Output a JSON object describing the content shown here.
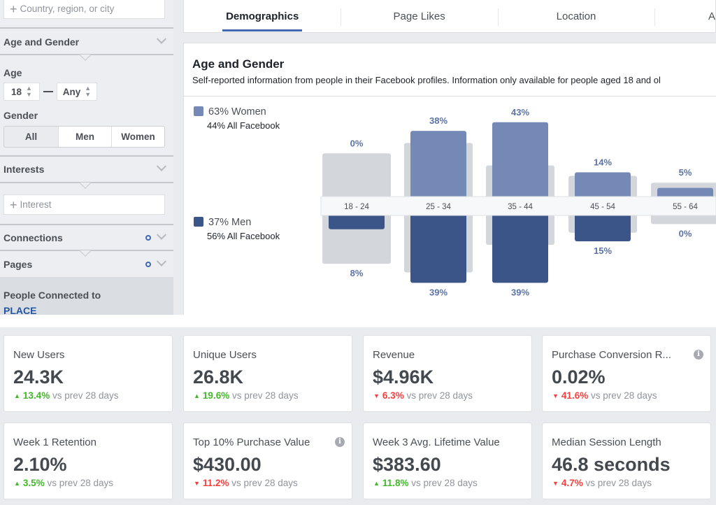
{
  "sidebar": {
    "location_placeholder": "Country, region, or city",
    "sections": {
      "age_gender": "Age and Gender",
      "interests": "Interests",
      "connections": "Connections",
      "pages": "Pages"
    },
    "age_label": "Age",
    "age_min": "18",
    "age_max": "Any",
    "gender_label": "Gender",
    "gender_options": [
      "All",
      "Men",
      "Women"
    ],
    "gender_selected": "All",
    "interest_placeholder": "Interest",
    "people_connected_label": "People Connected to",
    "people_connected_value": "PLACE"
  },
  "tabs": [
    {
      "label": "Demographics",
      "active": true
    },
    {
      "label": "Page Likes",
      "active": false
    },
    {
      "label": "Location",
      "active": false
    },
    {
      "label": "A",
      "active": false
    }
  ],
  "panel": {
    "title": "Age and Gender",
    "subtitle": "Self-reported information from people in their Facebook profiles. Information only available for people aged 18 and ol"
  },
  "legend": {
    "women": {
      "label": "63% Women",
      "sub": "44% All Facebook",
      "color": "#7489b6"
    },
    "men": {
      "label": "37% Men",
      "sub": "56% All Facebook",
      "color": "#3b5589"
    }
  },
  "chart_data": {
    "type": "bar",
    "title": "Age and Gender",
    "categories": [
      "18 - 24",
      "25 - 34",
      "35 - 44",
      "45 - 54",
      "55 - 64"
    ],
    "series": [
      {
        "name": "Women",
        "values": [
          0,
          38,
          43,
          14,
          5
        ],
        "labels": [
          "0%",
          "38%",
          "43%",
          "14%",
          "5%"
        ],
        "color": "#7489b6",
        "direction": "up"
      },
      {
        "name": "Men",
        "values": [
          8,
          39,
          39,
          15,
          0
        ],
        "labels": [
          "8%",
          "39%",
          "39%",
          "15%",
          "0%"
        ],
        "color": "#3b5589",
        "direction": "down"
      },
      {
        "name": "All Facebook Women",
        "values": [
          25,
          31,
          18,
          12,
          8
        ],
        "color": "#d3d6db",
        "direction": "up"
      },
      {
        "name": "All Facebook Men",
        "values": [
          28,
          33,
          17,
          10,
          5
        ],
        "color": "#d3d6db",
        "direction": "down"
      }
    ],
    "unit": "%",
    "grid": false
  },
  "colors": {
    "accent": "#4267b2",
    "women": "#7489b6",
    "men": "#3b5589",
    "baseline": "#d3d6db",
    "label": "#5b73a6",
    "up": "#42b72a",
    "down": "#fa3e3e"
  },
  "metrics": [
    {
      "title": "New Users",
      "value": "24.3K",
      "delta": "13.4%",
      "trend": "up",
      "suffix": "vs prev 28 days",
      "info": false
    },
    {
      "title": "Unique Users",
      "value": "26.8K",
      "delta": "19.6%",
      "trend": "up",
      "suffix": "vs prev 28 days",
      "info": false
    },
    {
      "title": "Revenue",
      "value": "$4.96K",
      "delta": "6.3%",
      "trend": "down",
      "suffix": "vs prev 28 days",
      "info": false
    },
    {
      "title": "Purchase Conversion R...",
      "value": "0.02%",
      "delta": "41.6%",
      "trend": "down",
      "suffix": "vs prev 28 days",
      "info": true
    },
    {
      "title": "Week 1 Retention",
      "value": "2.10%",
      "delta": "3.5%",
      "trend": "up",
      "suffix": "vs prev 28 days",
      "info": false
    },
    {
      "title": "Top 10% Purchase Value",
      "value": "$430.00",
      "delta": "11.2%",
      "trend": "down",
      "suffix": "vs prev 28 days",
      "info": true
    },
    {
      "title": "Week 3 Avg. Lifetime Value",
      "value": "$383.60",
      "delta": "11.8%",
      "trend": "up",
      "suffix": "vs prev 28 days",
      "info": false
    },
    {
      "title": "Median Session Length",
      "value": "46.8 seconds",
      "delta": "4.7%",
      "trend": "down",
      "suffix": "vs prev 28 days",
      "info": false
    }
  ]
}
